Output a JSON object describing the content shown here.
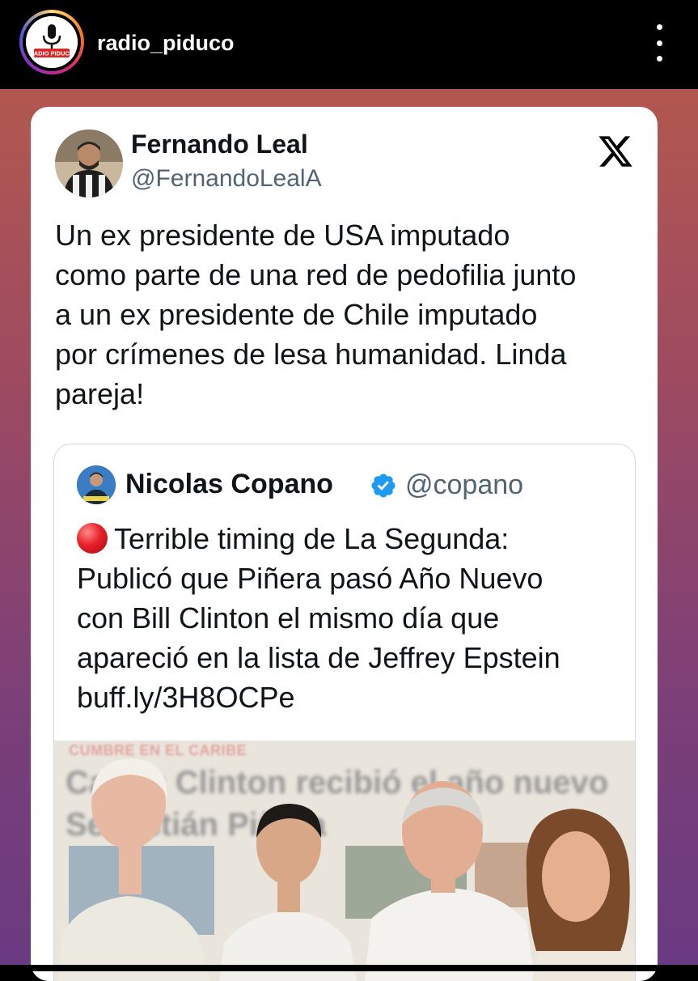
{
  "header": {
    "account_name": "radio_piduco",
    "avatar_logo_text": "RADIO PIDUCO",
    "more_icon": "more-vertical-icon"
  },
  "tweet": {
    "author_name": "Fernando Leal",
    "author_handle": "@FernandoLealA",
    "platform_icon": "x-logo-icon",
    "text_lines": [
      "Un ex presidente de USA imputado",
      "como parte de una red de pedofilia junto",
      "a un ex presidente de Chile imputado",
      "por crímenes de lesa humanidad. Linda",
      "pareja!"
    ],
    "quote": {
      "author_name": "Nicolas Copano",
      "verified_icon": "verified-badge-icon",
      "author_handle": "@copano",
      "status_icon": "red-circle-icon",
      "text_lines": [
        "Terrible timing de La Segunda:",
        "Publicó que Piñera pasó Año Nuevo",
        "con Bill Clinton el mismo día que",
        "apareció en la lista de Jeffrey Epstein",
        "buff.ly/3H8OCPe"
      ],
      "media": {
        "kicker": "CUMBRE EN EL CARIBE",
        "headline": "Carlos Clinton recibió el año nuevo Sebastián Piñera"
      }
    }
  },
  "colors": {
    "header_bg": "#000000",
    "gradient_top": "#b2574f",
    "gradient_bottom": "#6a3a82",
    "card_bg": "#ffffff",
    "text_primary": "#0f1419",
    "text_secondary": "#536471",
    "verified_blue": "#1d9bf0"
  }
}
